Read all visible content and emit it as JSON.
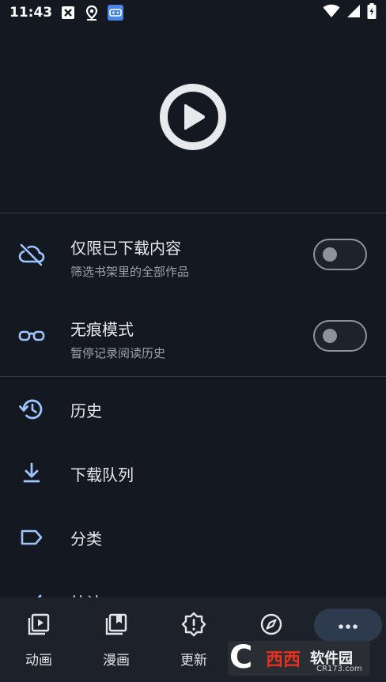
{
  "status_bar": {
    "time": "11:43",
    "left_icons": [
      "close-box-icon",
      "location-pin-icon",
      "game-controller-icon"
    ],
    "right_icons": [
      "wifi-icon",
      "signal-icon",
      "battery-charging-icon"
    ]
  },
  "hero": {
    "logo_icon": "play-circle-icon"
  },
  "settings": [
    {
      "icon": "cloud-off-icon",
      "title": "仅限已下载内容",
      "subtitle": "筛选书架里的全部作品",
      "toggle": false
    },
    {
      "icon": "glasses-icon",
      "title": "无痕模式",
      "subtitle": "暂停记录阅读历史",
      "toggle": false
    }
  ],
  "menu": [
    {
      "icon": "history-icon",
      "label": "历史"
    },
    {
      "icon": "download-icon",
      "label": "下载队列"
    },
    {
      "icon": "label-icon",
      "label": "分类"
    },
    {
      "icon": "stats-icon",
      "label": "统计"
    }
  ],
  "bottom_nav": [
    {
      "icon": "video-library-icon",
      "label": "动画"
    },
    {
      "icon": "collections-bookmark-icon",
      "label": "漫画"
    },
    {
      "icon": "alert-badge-icon",
      "label": "更新"
    },
    {
      "icon": "explore-icon",
      "label": ""
    },
    {
      "icon": "more-horiz-icon",
      "label": "",
      "selected": true
    }
  ],
  "watermark": {
    "mark": "C",
    "brand": "西西",
    "name": "软件园",
    "url": "CR173.com"
  },
  "colors": {
    "background": "#141820",
    "nav_background": "#1d2129",
    "icon_accent": "#9ec5ff",
    "selected_pill": "#2e3b4e"
  }
}
